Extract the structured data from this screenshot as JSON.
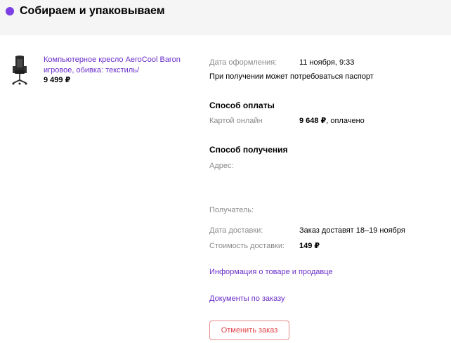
{
  "header": {
    "status_title": "Собираем и упаковываем",
    "status_color": "#7b3fe4"
  },
  "product": {
    "name": "Компьютерное кресло AeroCool Baron игровое, обивка: текстиль/",
    "price": "9 499 ₽",
    "image_icon": "office-chair-icon"
  },
  "order": {
    "date_label": "Дата оформления:",
    "date_value": "11 ноября, 9:33",
    "passport_note": "При получении может потребоваться паспорт"
  },
  "payment": {
    "title": "Способ оплаты",
    "method_label": "Картой онлайн",
    "amount": "9 648 ₽",
    "status": ", оплачено"
  },
  "delivery": {
    "title": "Способ получения",
    "address_label": "Адрес:",
    "recipient_label": "Получатель:",
    "date_label": "Дата доставки:",
    "date_value": "Заказ доставят 18–19 ноября",
    "cost_label": "Стоимость доставки:",
    "cost_value": "149 ₽"
  },
  "links": {
    "product_info": "Информация о товаре и продавце",
    "documents": "Документы по заказу"
  },
  "actions": {
    "cancel_label": "Отменить заказ"
  },
  "colors": {
    "accent": "#6b2fc9",
    "danger": "#e0454b",
    "header_bg": "#f5f5f5"
  }
}
